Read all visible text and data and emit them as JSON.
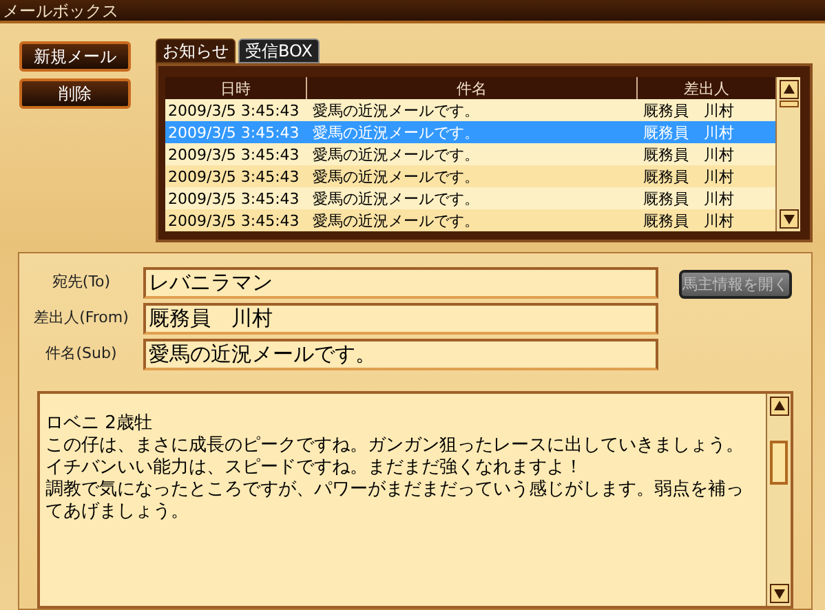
{
  "window": {
    "title": "メールボックス"
  },
  "actions": [
    {
      "label": "新規メール"
    },
    {
      "label": "削除"
    }
  ],
  "tabs": [
    {
      "label": "お知らせ",
      "selected": true
    },
    {
      "label": "受信BOX",
      "selected": false
    }
  ],
  "table": {
    "columns": [
      "日時",
      "件名",
      "差出人"
    ],
    "rows": [
      {
        "cells": [
          "2009/3/5 3:45:43",
          "愛馬の近況メールです。",
          "厩務員　川村"
        ],
        "selected": false
      },
      {
        "cells": [
          "2009/3/5 3:45:43",
          "愛馬の近況メールです。",
          "厩務員　川村"
        ],
        "selected": true
      },
      {
        "cells": [
          "2009/3/5 3:45:43",
          "愛馬の近況メールです。",
          "厩務員　川村"
        ],
        "selected": false
      },
      {
        "cells": [
          "2009/3/5 3:45:43",
          "愛馬の近況メールです。",
          "厩務員　川村"
        ],
        "selected": false
      },
      {
        "cells": [
          "2009/3/5 3:45:43",
          "愛馬の近況メールです。",
          "厩務員　川村"
        ],
        "selected": false
      },
      {
        "cells": [
          "2009/3/5 3:45:43",
          "愛馬の近況メールです。",
          "厩務員　川村"
        ],
        "selected": false
      }
    ]
  },
  "fields": [
    {
      "label": "宛先(To)",
      "value": "レバニラマン"
    },
    {
      "label": "差出人(From)",
      "value": "厩務員　川村"
    },
    {
      "label": "件名(Sub)",
      "value": "愛馬の近況メールです。"
    }
  ],
  "owner_button": {
    "label": "馬主情報を開く",
    "disabled": true
  },
  "message": [
    "ロベニ 2歳牡",
    "この仔は、まさに成長のピークですね。ガンガン狙ったレースに出していきましょう。",
    "イチバンいい能力は、スピードですね。まだまだ強くなれますよ！",
    "調教で気になったところですが、パワーがまだまだっていう感じがします。弱点を補ってあげましょう。"
  ]
}
